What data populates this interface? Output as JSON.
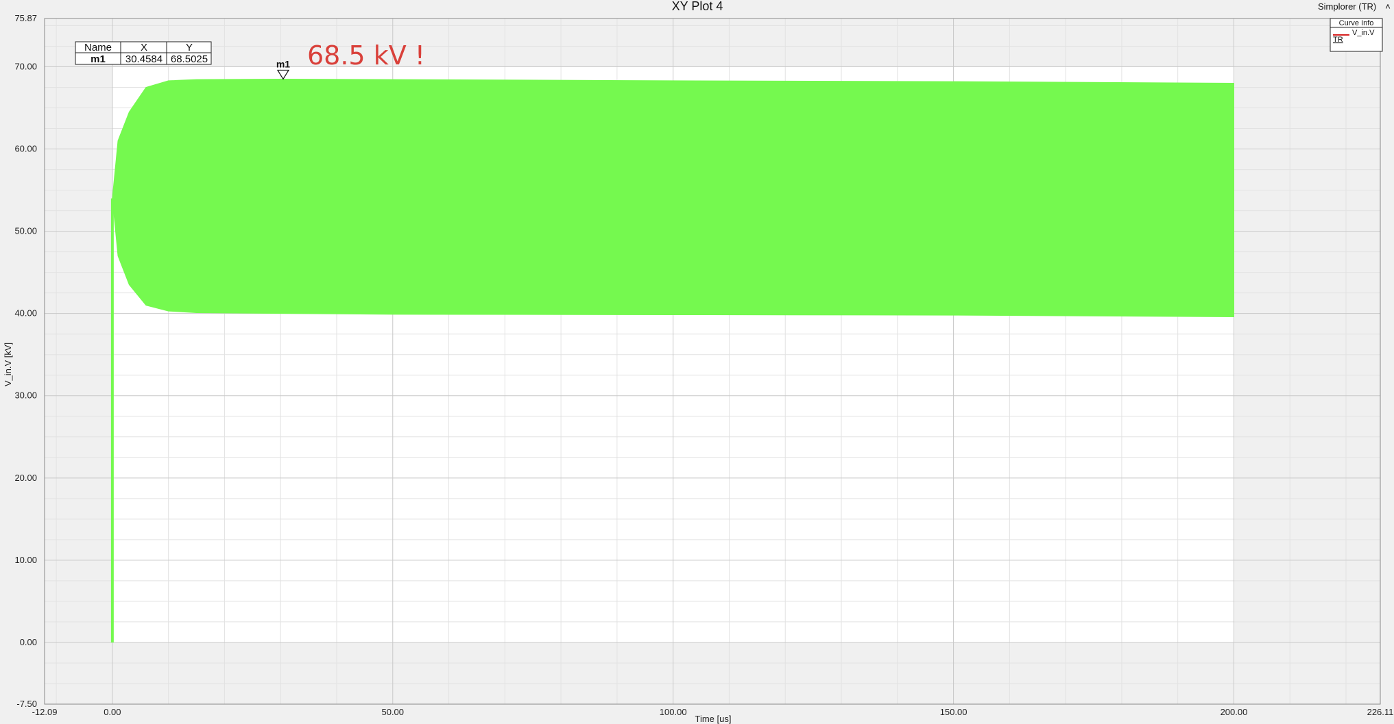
{
  "window": {
    "title": "XY Plot 4",
    "context_label": "Simplorer (TR)",
    "collapse_glyph": "˄"
  },
  "colors": {
    "panel_bg": "#f0f0f0",
    "plot_bg": "#ffffff",
    "grid_major": "#c8c8c8",
    "grid_minor": "#e2e2e2",
    "trace": "#75f94f",
    "annotation": "#d9403a",
    "legend_line": "#d62020"
  },
  "annotation": {
    "text": "68.5 kV !"
  },
  "marker": {
    "name": "m1",
    "x": 30.4584,
    "y": 68.5025
  },
  "marker_table": {
    "headers": [
      "Name",
      "X",
      "Y"
    ],
    "rows": [
      [
        "m1",
        "30.4584",
        "68.5025"
      ]
    ]
  },
  "curve_info": {
    "title": "Curve Info",
    "entries": [
      {
        "label": "V_in.V",
        "sublabel": "TR",
        "color": "#d62020"
      }
    ]
  },
  "chart_data": {
    "type": "area",
    "title": "XY Plot 4",
    "xlabel": "Time [us]",
    "ylabel": "V_in.V [kV]",
    "xlim": [
      -12.09,
      226.11
    ],
    "ylim": [
      -7.5,
      75.87
    ],
    "x_ticks": [
      0,
      50,
      100,
      150,
      200
    ],
    "x_tick_labels": [
      "-12.09",
      "0.00",
      "50.00",
      "100.00",
      "150.00",
      "200.00",
      "226.11"
    ],
    "y_ticks": [
      0,
      10,
      20,
      30,
      40,
      50,
      60,
      70
    ],
    "y_tick_labels": [
      "75.87",
      "70.00",
      "60.00",
      "50.00",
      "40.00",
      "30.00",
      "20.00",
      "10.00",
      "0.00",
      "-7.50"
    ],
    "grid": true,
    "legend_placement": "top-right",
    "series": [
      {
        "name": "V_in.V",
        "color": "#75f94f",
        "description_upper": [
          [
            0,
            54
          ],
          [
            1,
            61
          ],
          [
            3,
            64.5
          ],
          [
            6,
            67.5
          ],
          [
            10,
            68.3
          ],
          [
            15,
            68.45
          ],
          [
            30.4584,
            68.5025
          ],
          [
            50,
            68.45
          ],
          [
            100,
            68.3
          ],
          [
            150,
            68.2
          ],
          [
            200,
            68.0
          ]
        ],
        "description_lower": [
          [
            0,
            54
          ],
          [
            1,
            47
          ],
          [
            3,
            43.5
          ],
          [
            6,
            41
          ],
          [
            10,
            40.3
          ],
          [
            15,
            40.1
          ],
          [
            30.4584,
            40.0
          ],
          [
            50,
            39.9
          ],
          [
            100,
            39.85
          ],
          [
            150,
            39.8
          ],
          [
            200,
            39.6
          ]
        ],
        "initial_spike": [
          [
            0,
            0
          ],
          [
            0,
            54
          ]
        ]
      }
    ]
  }
}
